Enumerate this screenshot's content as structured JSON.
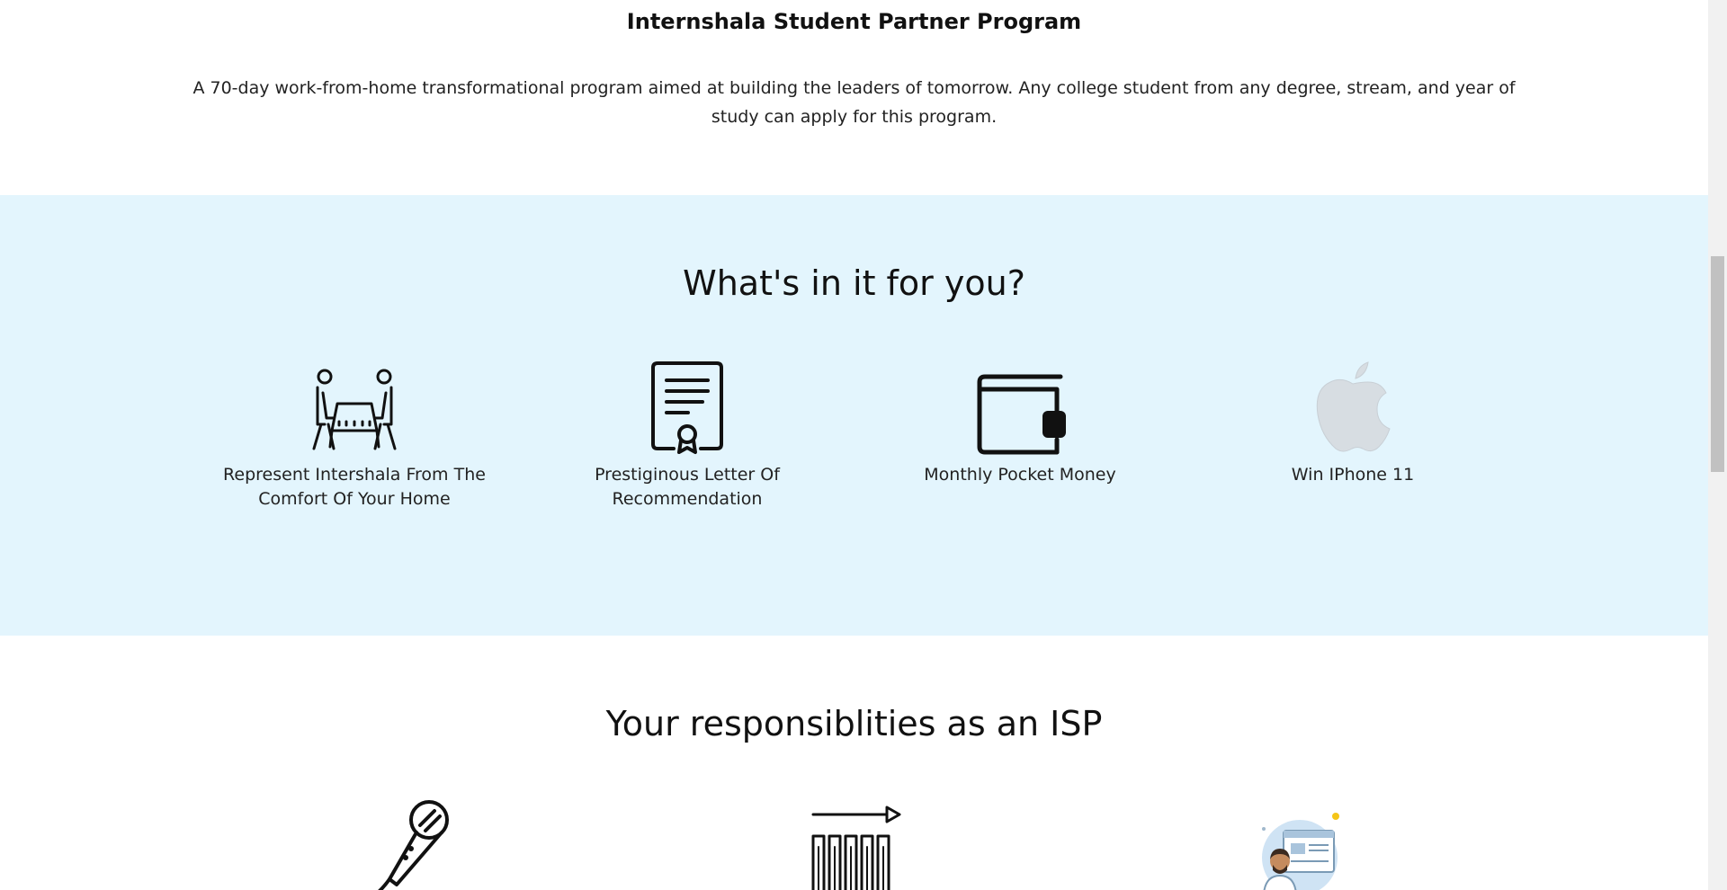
{
  "intro": {
    "title": "Internshala Student Partner Program",
    "description": "A 70-day work-from-home transformational program aimed at building the leaders of tomorrow. Any college student from any degree, stream, and year of study can apply for this program."
  },
  "benefits": {
    "heading": "What's in it for you?",
    "items": [
      {
        "icon": "meeting-table-icon",
        "label": "Represent Intershala From The Comfort Of Your Home"
      },
      {
        "icon": "certificate-icon",
        "label": "Prestiginous Letter Of Recommendation"
      },
      {
        "icon": "wallet-icon",
        "label": "Monthly Pocket Money"
      },
      {
        "icon": "apple-logo-icon",
        "label": "Win IPhone 11"
      }
    ]
  },
  "responsibilities": {
    "heading": "Your responsiblities as an ISP",
    "icons": [
      "microphone-icon",
      "growth-chart-icon",
      "presenter-avatar-icon"
    ]
  },
  "colors": {
    "benefits_bg": "#e3f5fd",
    "text": "#111111"
  }
}
